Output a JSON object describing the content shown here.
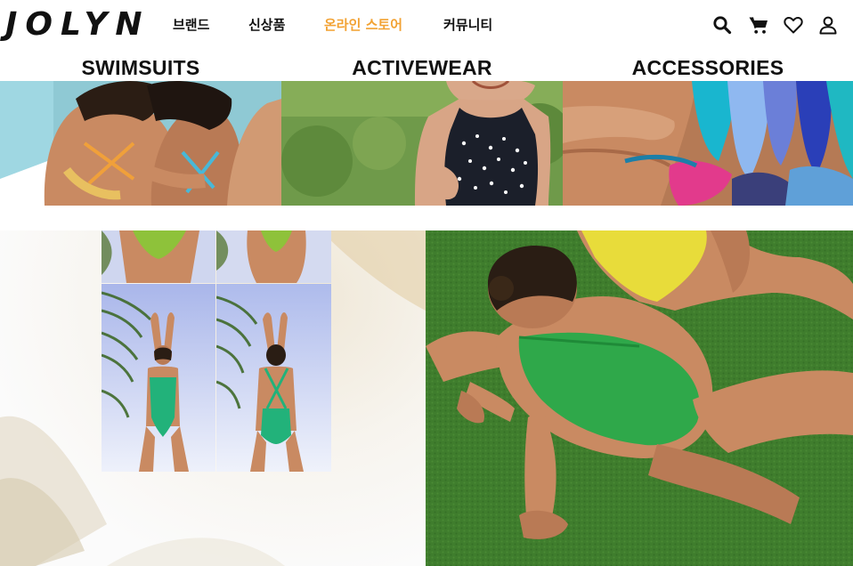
{
  "brand": {
    "logo_text": "JOLYN"
  },
  "nav": {
    "items": [
      {
        "label": "브랜드",
        "active": false
      },
      {
        "label": "신상품",
        "active": false
      },
      {
        "label": "온라인 스토어",
        "active": true
      },
      {
        "label": "커뮤니티",
        "active": false
      }
    ],
    "active_color": "#f2a233"
  },
  "header_icons": [
    "search-icon",
    "cart-icon",
    "heart-icon",
    "user-icon"
  ],
  "categories": [
    {
      "title": "SWIMSUITS"
    },
    {
      "title": "ACTIVEWEAR"
    },
    {
      "title": "ACCESSORIES"
    }
  ],
  "colors": {
    "text": "#111111",
    "background": "#ffffff",
    "accent": "#f2a233",
    "swim_green": "#22b27a",
    "grass_green": "#3d7a2c",
    "suit_yellow": "#e8dc3a"
  }
}
